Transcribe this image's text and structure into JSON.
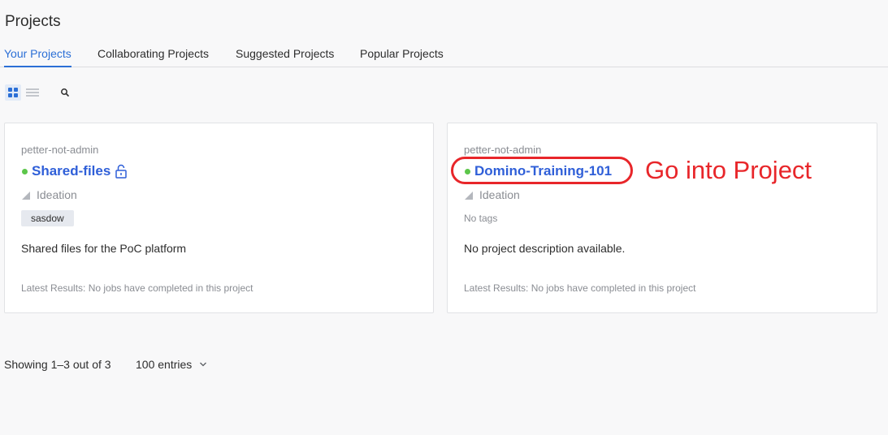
{
  "page": {
    "title": "Projects"
  },
  "tabs": [
    {
      "label": "Your Projects",
      "active": true
    },
    {
      "label": "Collaborating Projects",
      "active": false
    },
    {
      "label": "Suggested Projects",
      "active": false
    },
    {
      "label": "Popular Projects",
      "active": false
    }
  ],
  "toolbar": {
    "grid_view_icon": "grid-icon",
    "list_view_icon": "list-icon",
    "search_icon": "search-icon",
    "active_view": "grid"
  },
  "projects": [
    {
      "owner": "petter-not-admin",
      "name": "Shared-files",
      "status_color": "#5cc64a",
      "lock_icon": "unlock-icon",
      "stage": "Ideation",
      "tags": [
        "sasdow"
      ],
      "description": "Shared files for the PoC platform",
      "latest_results": "Latest Results: No jobs have completed in this project"
    },
    {
      "owner": "petter-not-admin",
      "name": "Domino-Training-101",
      "status_color": "#5cc64a",
      "stage": "Ideation",
      "no_tags_text": "No tags",
      "description": "No project description available.",
      "latest_results": "Latest Results: No jobs have completed in this project"
    }
  ],
  "annotation": {
    "text": "Go into Project",
    "color": "#e8262a"
  },
  "footer": {
    "showing": "Showing 1–3 out of 3",
    "entries_label": "100 entries"
  },
  "colors": {
    "accent": "#2b6fd6",
    "project_link": "#2f5fd8",
    "status_active": "#5cc64a"
  }
}
